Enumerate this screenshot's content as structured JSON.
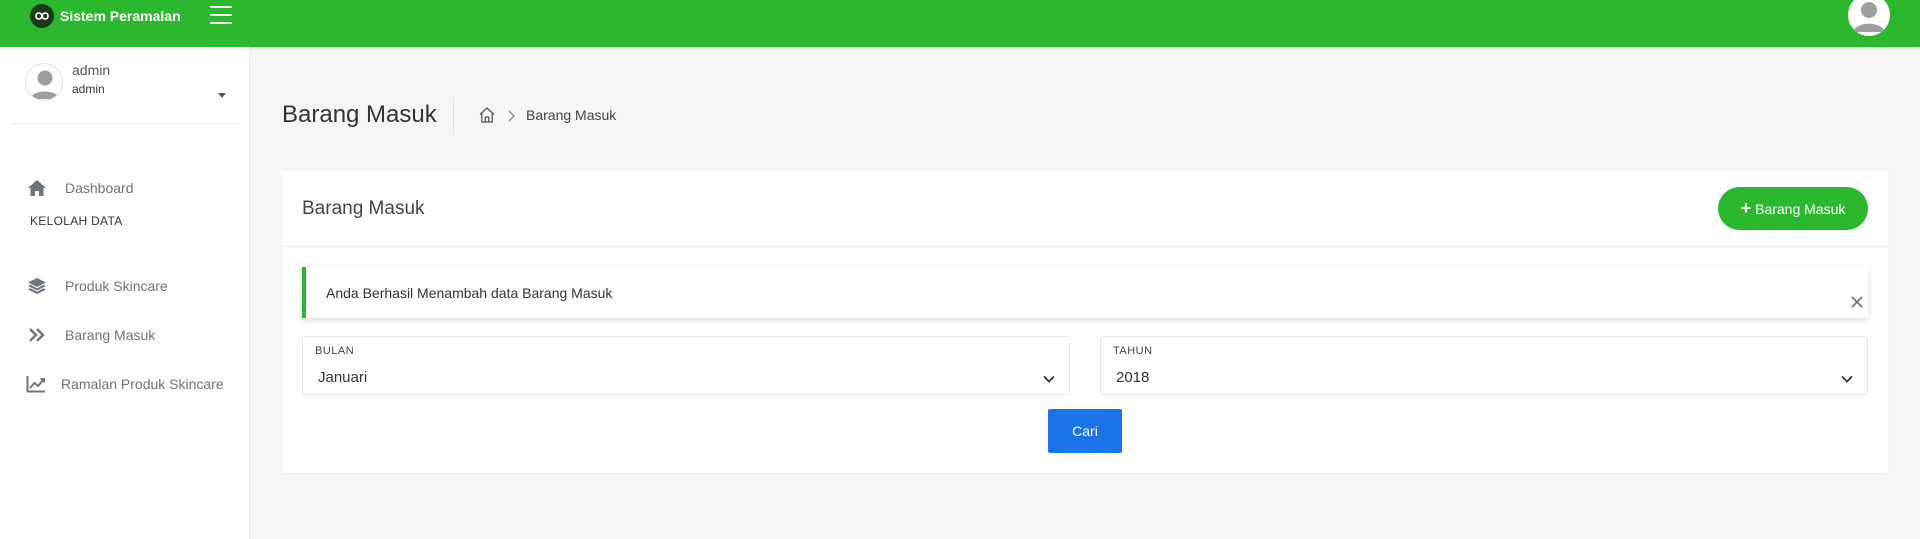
{
  "app": {
    "brand_name": "Sistem Peramalan",
    "accent_color": "#2cb82e",
    "button_blue": "#1a73e8"
  },
  "user": {
    "name": "admin",
    "role": "admin"
  },
  "sidebar": {
    "items": [
      {
        "label": "Dashboard",
        "icon": "home-icon"
      },
      {
        "label": "Produk Skincare",
        "icon": "layers-icon"
      },
      {
        "label": "Barang Masuk",
        "icon": "double-chevron-right-icon"
      },
      {
        "label": "Ramalan Produk Skincare",
        "icon": "line-chart-icon"
      }
    ],
    "section_label": "KELOLAH DATA"
  },
  "header": {
    "page_title": "Barang Masuk",
    "breadcrumb_current": "Barang Masuk"
  },
  "card": {
    "title": "Barang Masuk",
    "add_button_label": "Barang Masuk",
    "alert_message": "Anda Berhasil Menambah data Barang Masuk",
    "bulan": {
      "label": "BULAN",
      "value": "Januari"
    },
    "tahun": {
      "label": "TAHUN",
      "value": "2018"
    },
    "search_button_label": "Cari"
  }
}
